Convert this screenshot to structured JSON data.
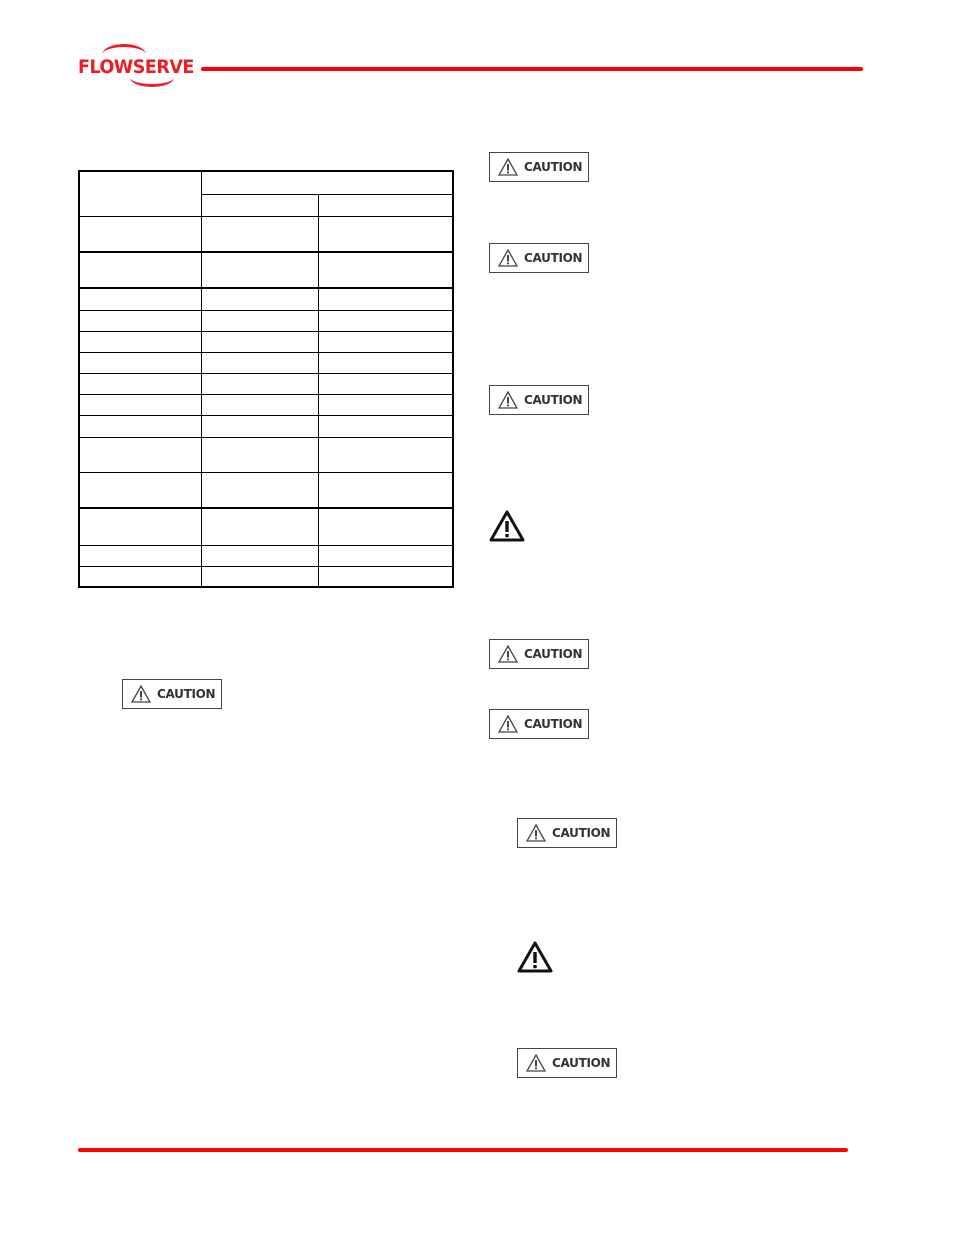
{
  "header": {
    "brand": "FLOWSERVE",
    "brand_color": "#ee1c25",
    "rule_color": "#ff0000"
  },
  "table": {
    "columns": 3,
    "header_rows": [
      [
        "",
        "",
        ""
      ],
      [
        "",
        "",
        ""
      ]
    ],
    "rows": [
      [
        "",
        "",
        ""
      ],
      [
        "",
        "",
        ""
      ],
      [
        "",
        "",
        ""
      ],
      [
        "",
        "",
        ""
      ],
      [
        "",
        "",
        ""
      ],
      [
        "",
        "",
        ""
      ],
      [
        "",
        "",
        ""
      ],
      [
        "",
        "",
        ""
      ],
      [
        "",
        "",
        ""
      ],
      [
        "",
        "",
        ""
      ],
      [
        "",
        "",
        ""
      ],
      [
        "",
        "",
        ""
      ],
      [
        "",
        "",
        ""
      ]
    ]
  },
  "labels": {
    "caution": "CAUTION",
    "caution_icon": "warning-triangle-icon",
    "warning_icon": "warning-triangle-icon"
  },
  "footer": {
    "rule_color": "#ff0000"
  }
}
